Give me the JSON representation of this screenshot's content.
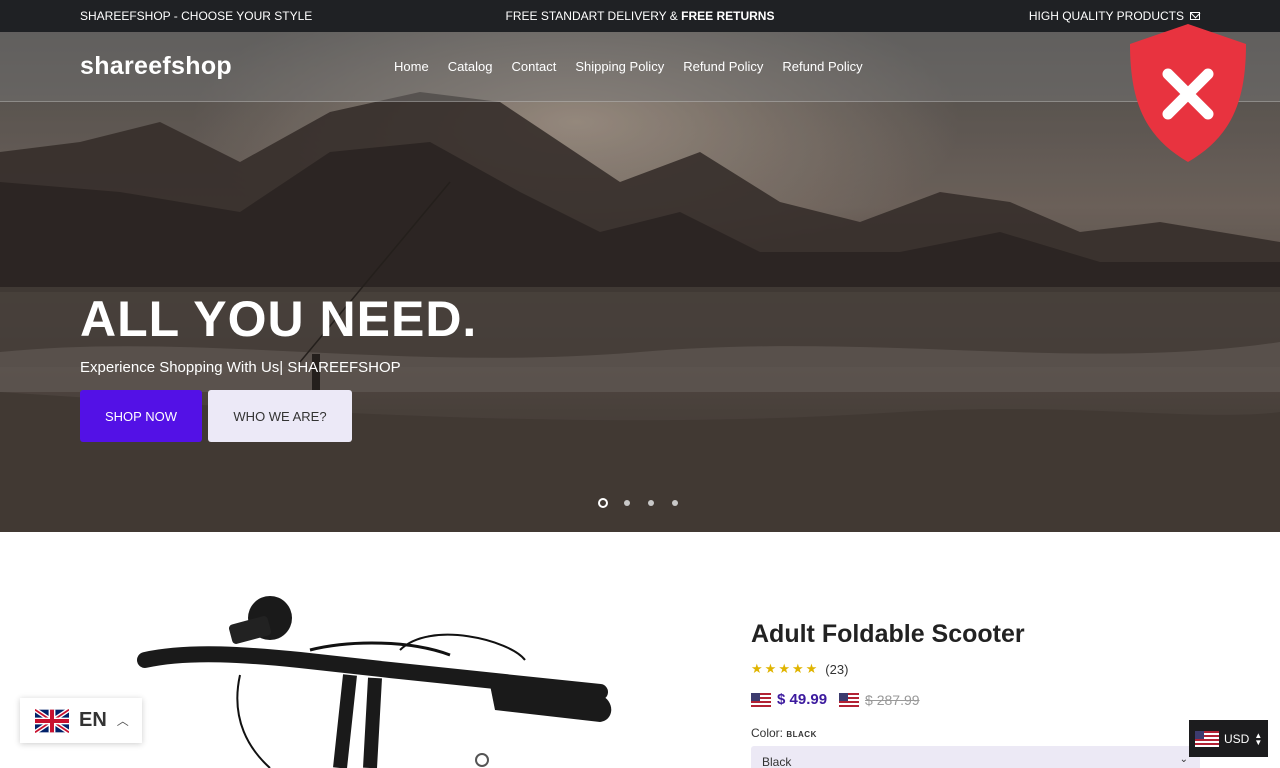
{
  "topbar": {
    "left": "SHAREEFSHOP - CHOOSE YOUR STYLE",
    "center_prefix": "FREE STANDART DELIVERY &",
    "center_bold": "FREE RETURNS",
    "right": "HIGH QUALITY PRODUCTS",
    "right_icon": "mail-icon"
  },
  "header": {
    "logo": "shareefshop",
    "nav": [
      "Home",
      "Catalog",
      "Contact",
      "Shipping Policy",
      "Refund Policy",
      "Refund Policy"
    ]
  },
  "hero": {
    "title": "ALL YOU NEED.",
    "subtitle": "Experience Shopping With Us| SHAREEFSHOP",
    "primary_button": "SHOP NOW",
    "secondary_button": "WHO WE ARE?",
    "slides": 4,
    "active_slide": 1
  },
  "overlay_badge": {
    "icon": "shield-x-icon",
    "color": "#e8333f"
  },
  "product": {
    "title": "Adult Foldable Scooter",
    "rating_stars": 5,
    "review_count": "(23)",
    "price": "$ 49.99",
    "old_price": "$ 287.99",
    "color_label": "Color:",
    "color_value": "BLACK",
    "selected_variant": "Black"
  },
  "language": {
    "code": "EN",
    "flag": "uk-flag-icon"
  },
  "currency": {
    "code": "USD",
    "flag": "us-flag-icon"
  },
  "colors": {
    "accent": "#5311e6",
    "topbar": "#1f2124",
    "price": "#3c1a9e"
  }
}
